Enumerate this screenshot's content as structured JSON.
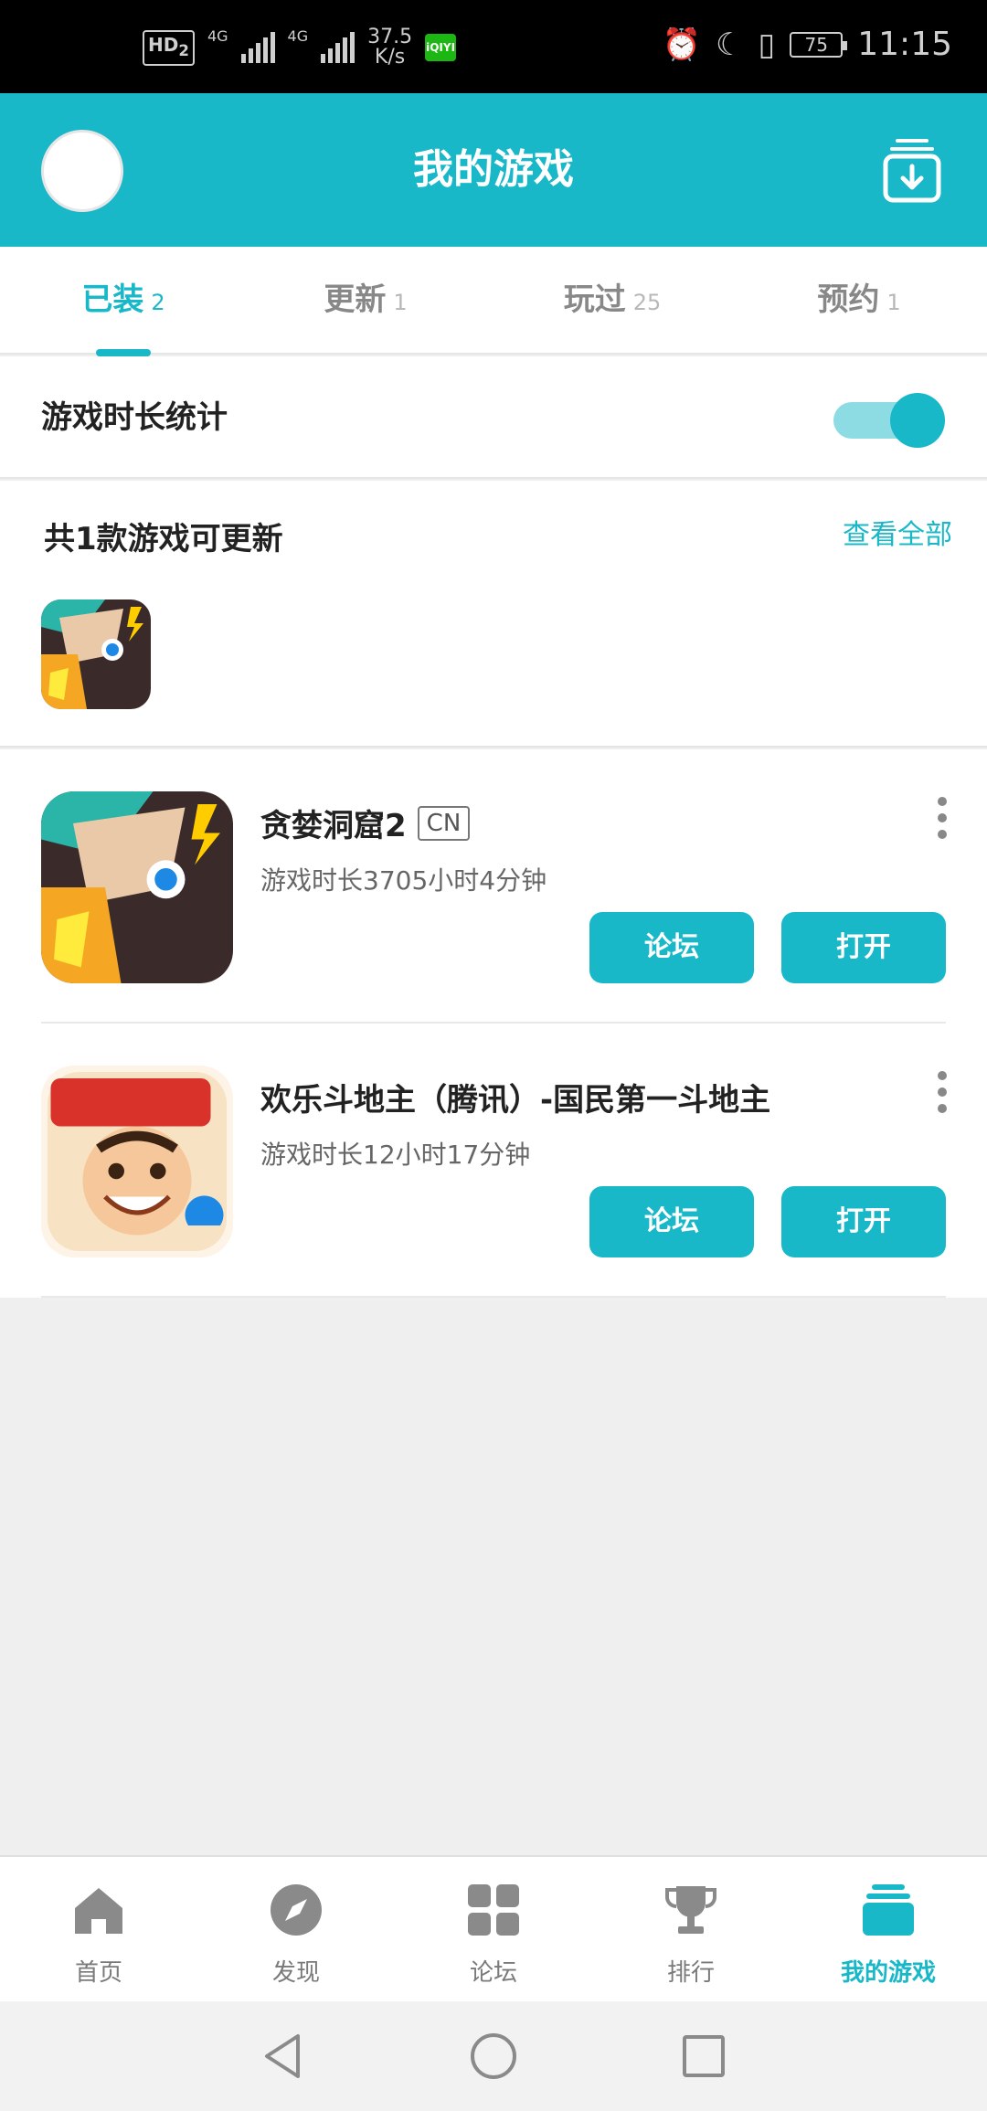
{
  "status_bar": {
    "hd": "HD",
    "hd_sub": "2",
    "sim1": "4G",
    "sim2": "4G",
    "net_speed": "37.5",
    "net_unit": "K/s",
    "iqiyi": "iQIYI",
    "battery": "75",
    "time": "11:15"
  },
  "header": {
    "title": "我的游戏"
  },
  "tabs": [
    {
      "label": "已装",
      "count": "2"
    },
    {
      "label": "更新",
      "count": "1"
    },
    {
      "label": "玩过",
      "count": "25"
    },
    {
      "label": "预约",
      "count": "1"
    }
  ],
  "stats": {
    "label": "游戏时长统计",
    "enabled": true
  },
  "updates": {
    "title": "共1款游戏可更新",
    "view_all": "查看全部"
  },
  "games": [
    {
      "name": "贪婪洞窟2",
      "tag": "CN",
      "playtime": "游戏时长3705小时4分钟",
      "forum_label": "论坛",
      "open_label": "打开"
    },
    {
      "name": "欢乐斗地主（腾讯）-国民第一斗地主",
      "tag": "",
      "playtime": "游戏时长12小时17分钟",
      "forum_label": "论坛",
      "open_label": "打开"
    }
  ],
  "bottom_nav": [
    {
      "label": "首页",
      "icon": "home-icon"
    },
    {
      "label": "发现",
      "icon": "compass-icon"
    },
    {
      "label": "论坛",
      "icon": "grid-icon"
    },
    {
      "label": "排行",
      "icon": "trophy-icon"
    },
    {
      "label": "我的游戏",
      "icon": "stack-icon"
    }
  ],
  "colors": {
    "accent": "#18b8c8",
    "background": "#efefef"
  }
}
